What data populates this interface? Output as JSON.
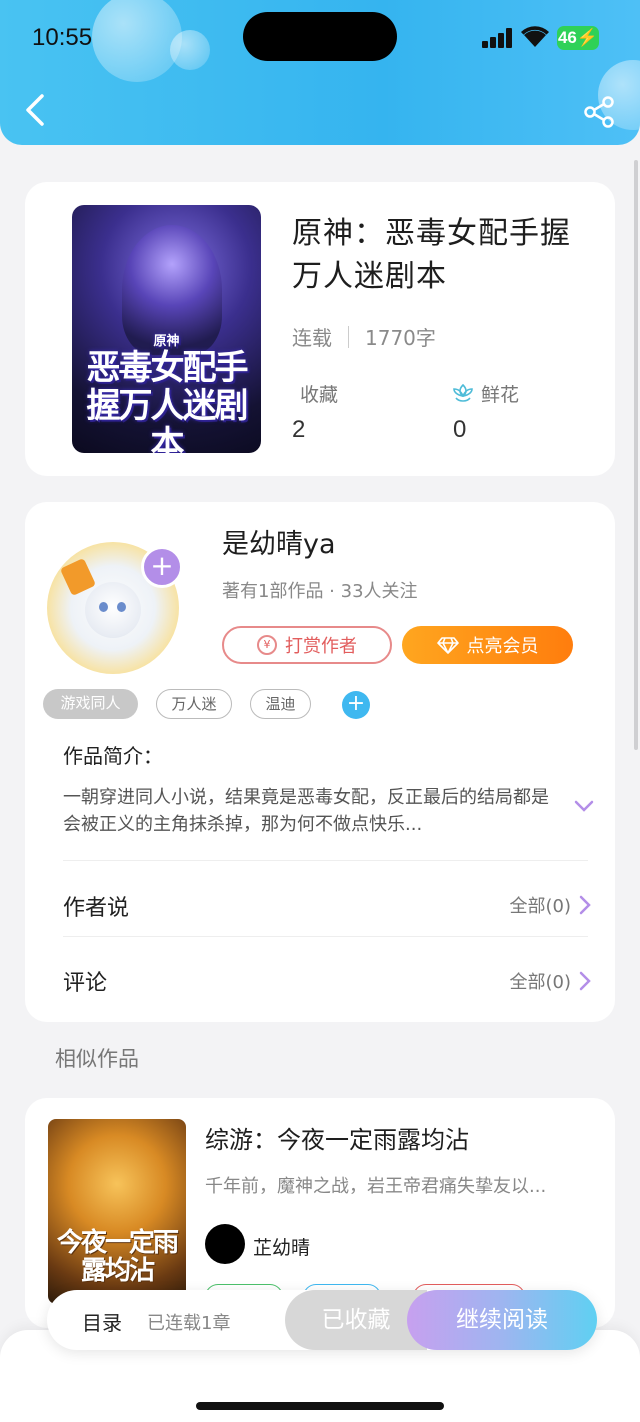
{
  "status_bar": {
    "time": "10:55",
    "battery": "46"
  },
  "header": {
    "back_icon": "chevron-left-icon",
    "share_icon": "share-icon"
  },
  "book": {
    "cover_title": "恶毒女配手握万人迷剧本",
    "cover_small": "原神",
    "title": "原神：恶毒女配手握万人迷剧本",
    "status": "连载",
    "word_count": "1770字",
    "collect_label": "收藏",
    "collect_count": "2",
    "flower_label": "鲜花",
    "flower_count": "0"
  },
  "author": {
    "name": "是幼晴ya",
    "sub": "著有1部作品 · 33人关注",
    "tip_label": "打赏作者",
    "vip_label": "点亮会员",
    "tags": [
      "游戏同人",
      "万人迷",
      "温迪"
    ]
  },
  "intro": {
    "label": "作品简介：",
    "text": "一朝穿进同人小说，结果竟是恶毒女配，反正最后的结局都是会被正义的主角抹杀掉，那为何不做点快乐..."
  },
  "author_says": {
    "label": "作者说",
    "right": "全部(0)"
  },
  "comments": {
    "label": "评论",
    "right": "全部(0)"
  },
  "similar": {
    "section_title": "相似作品",
    "items": [
      {
        "title": "综游：今夜一定雨露均沾",
        "desc": "千年前，魔神之战，岩王帝君痛失挚友以...",
        "author": "芷幼晴",
        "cover_title": "今夜一定雨露均沾",
        "tag_colors": [
          "#4cc06b",
          "#3fb8f0",
          "#e25d5d"
        ]
      }
    ]
  },
  "bottom_bar": {
    "toc_label": "目录",
    "toc_sub": "已连载1章",
    "collected_label": "已收藏",
    "read_label": "继续阅读"
  },
  "colors": {
    "header": "#35b4ef",
    "accent_purple": "#b38ee8",
    "vip_orange": "#ff8a12",
    "tip_red": "#e25d5d"
  }
}
